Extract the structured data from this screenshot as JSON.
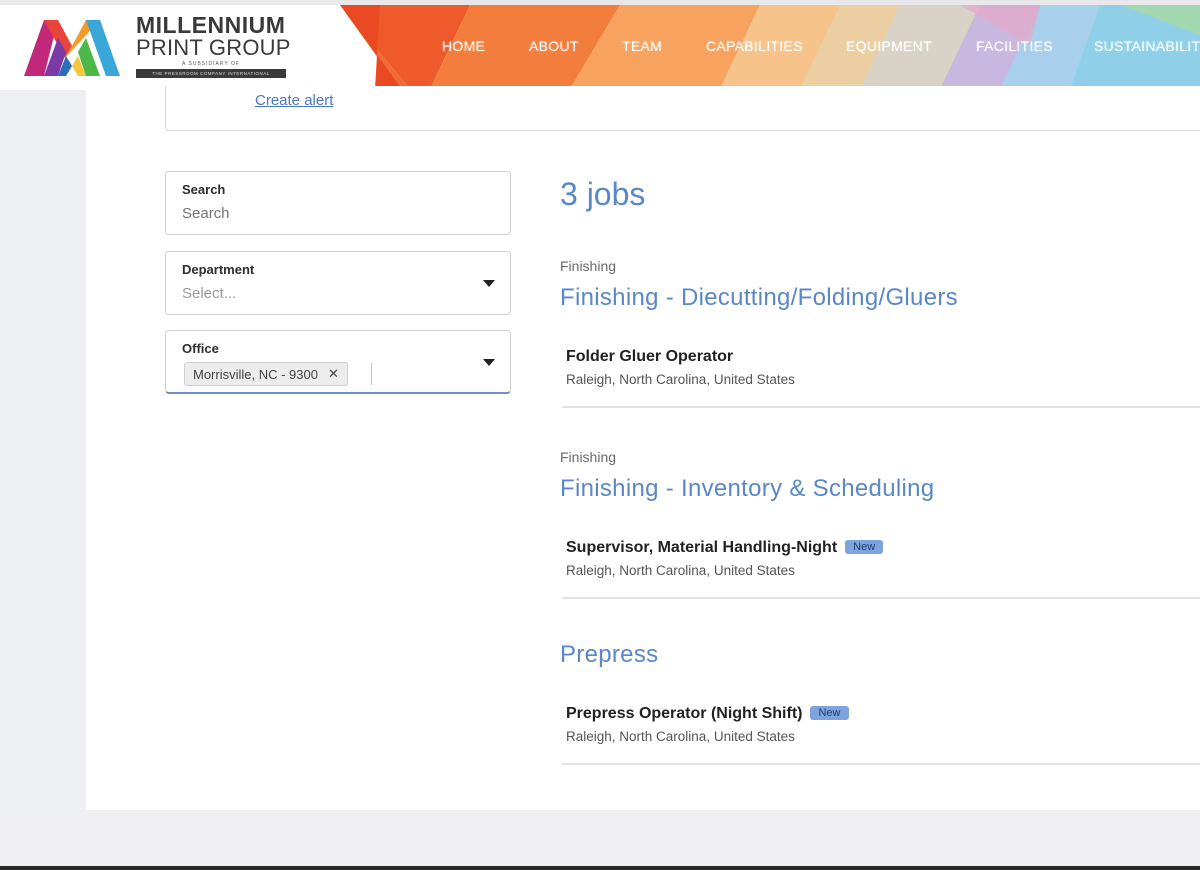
{
  "brand": {
    "line1": "MILLENNIUM",
    "line2": "PRINT GROUP",
    "subsidiary_line": "A SUBSIDIARY OF",
    "parent_company": "THE PRESSROOM COMPANY INTERNATIONAL"
  },
  "nav": {
    "items": [
      "HOME",
      "ABOUT",
      "TEAM",
      "CAPABILITIES",
      "EQUIPMENT",
      "FACILITIES",
      "SUSTAINABILITY"
    ]
  },
  "alert": {
    "link_label": "Create alert"
  },
  "filters": {
    "search": {
      "label": "Search",
      "placeholder": "Search"
    },
    "department": {
      "label": "Department",
      "placeholder": "Select..."
    },
    "office": {
      "label": "Office",
      "selected": "Morrisville, NC - 9300"
    }
  },
  "results": {
    "count_label": "3 jobs",
    "groups": [
      {
        "category": "Finishing",
        "title": "Finishing - Diecutting/Folding/Gluers",
        "jobs": [
          {
            "title": "Folder Gluer Operator",
            "location": "Raleigh, North Carolina, United States",
            "badge": ""
          }
        ]
      },
      {
        "category": "Finishing",
        "title": "Finishing - Inventory & Scheduling",
        "jobs": [
          {
            "title": "Supervisor, Material Handling-Night",
            "location": "Raleigh, North Carolina, United States",
            "badge": "New"
          }
        ]
      },
      {
        "category": "",
        "title": "Prepress",
        "jobs": [
          {
            "title": "Prepress Operator (Night Shift)",
            "location": "Raleigh, North Carolina, United States",
            "badge": "New"
          }
        ]
      }
    ]
  },
  "colors": {
    "accent": "#5a87c8",
    "link": "#4a78c2",
    "badge": "#7ea3dd"
  }
}
